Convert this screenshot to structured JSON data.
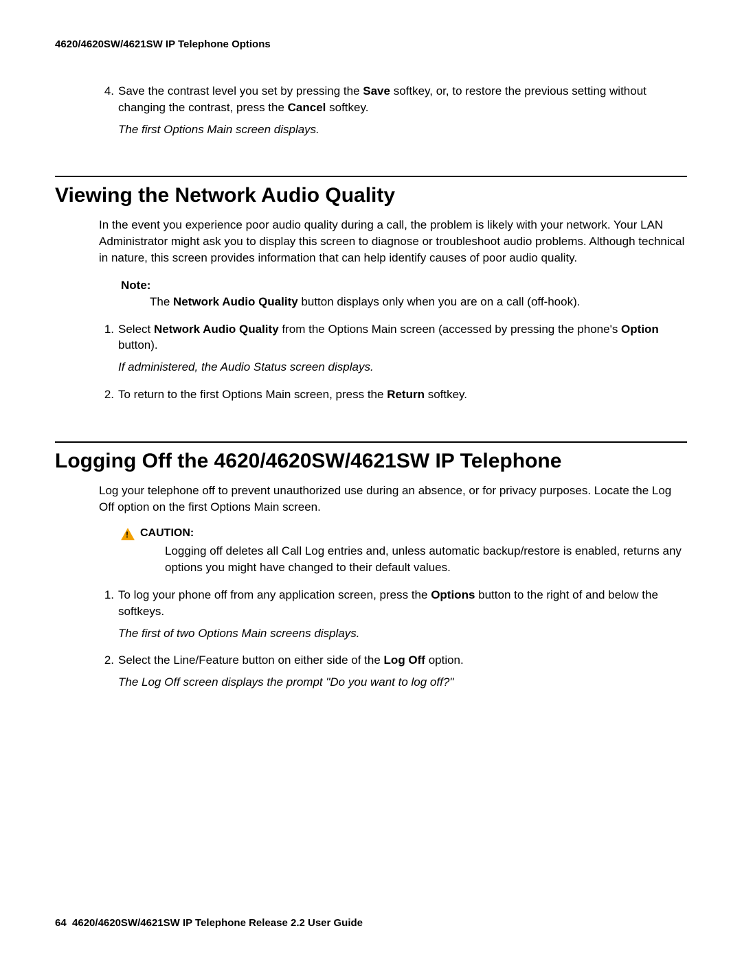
{
  "header": "4620/4620SW/4621SW IP Telephone Options",
  "intro": {
    "step4_marker": "4.",
    "step4_a": "Save the contrast level you set by pressing the ",
    "step4_b_bold": "Save",
    "step4_c": " softkey, or, to restore the previous setting without changing the contrast, press the ",
    "step4_d_bold": "Cancel",
    "step4_e": " softkey.",
    "step4_result": "The first Options Main screen displays."
  },
  "sec1": {
    "title": "Viewing the Network Audio Quality",
    "para": "In the event you experience poor audio quality during a call, the problem is likely with your network. Your LAN Administrator might ask you to display this screen to diagnose or troubleshoot audio problems. Although technical in nature, this screen provides information that can help identify causes of poor audio quality.",
    "note_label": "Note:",
    "note_a": "The ",
    "note_b_bold": "Network Audio Quality",
    "note_c": " button displays only when you are on a call (off-hook).",
    "step1_marker": "1.",
    "step1_a": "Select ",
    "step1_b_bold": "Network Audio Quality",
    "step1_c": " from the Options Main screen (accessed by pressing the phone's ",
    "step1_d_bold": "Option",
    "step1_e": " button).",
    "step1_result": "If administered, the Audio Status screen displays.",
    "step2_marker": "2.",
    "step2_a": "To return to the first Options Main screen, press the ",
    "step2_b_bold": "Return",
    "step2_c": " softkey."
  },
  "sec2": {
    "title": "Logging Off the 4620/4620SW/4621SW IP Telephone",
    "para": "Log your telephone off to prevent unauthorized use during an absence, or for privacy purposes. Locate the Log Off option on the first Options Main screen.",
    "caution_label": "CAUTION:",
    "caution_body": "Logging off deletes all Call Log entries and, unless automatic backup/restore is enabled, returns any options you might have changed to their default values.",
    "step1_marker": "1.",
    "step1_a": "To log your phone off from any application screen, press the ",
    "step1_b_bold": "Options",
    "step1_c": " button to the right of and below the softkeys.",
    "step1_result": "The first of two Options Main screens displays.",
    "step2_marker": "2.",
    "step2_a": "Select the Line/Feature button on either side of the ",
    "step2_b_bold": "Log Off",
    "step2_c": " option.",
    "step2_result": "The Log Off screen displays the prompt \"Do you want to log off?\""
  },
  "footer": {
    "page": "64",
    "text": "4620/4620SW/4621SW IP Telephone Release 2.2 User Guide"
  }
}
